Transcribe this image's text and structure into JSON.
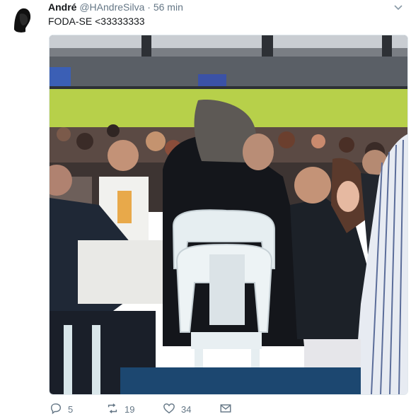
{
  "tweet": {
    "author_name": "André",
    "author_handle": "@HAndreSilva",
    "separator": "·",
    "timestamp": "56 min",
    "text": "FODA-SE <33333333"
  },
  "actions": {
    "reply_count": "5",
    "retweet_count": "19",
    "like_count": "34"
  },
  "icons": {
    "reply": "reply-icon",
    "retweet": "retweet-icon",
    "like": "heart-icon",
    "message": "envelope-icon",
    "menu": "chevron-down-icon"
  },
  "colors": {
    "text_primary": "#14171a",
    "text_secondary": "#657786",
    "border": "#e1e8ed"
  }
}
